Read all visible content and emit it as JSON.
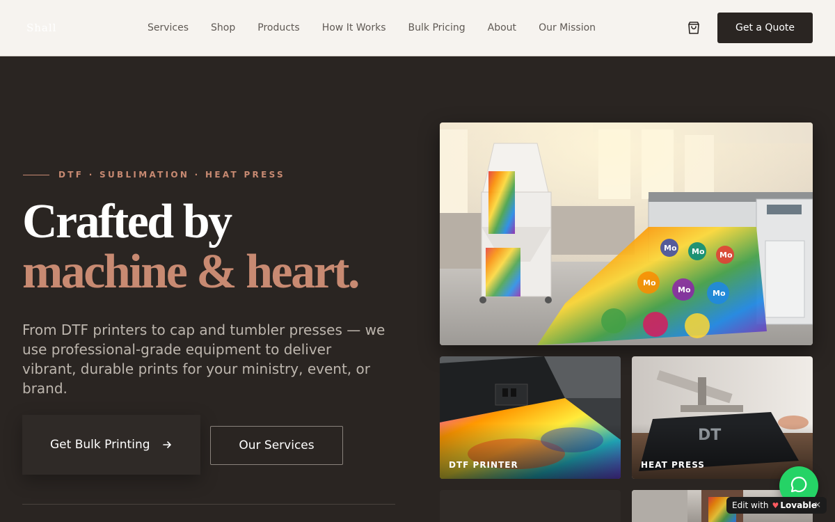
{
  "header": {
    "logo": "Shall",
    "nav": [
      "Services",
      "Shop",
      "Products",
      "How It Works",
      "Bulk Pricing",
      "About",
      "Our Mission"
    ],
    "cta": "Get a Quote"
  },
  "hero": {
    "eyebrow": "DTF · SUBLIMATION · HEAT PRESS",
    "title_line1": "Crafted by",
    "title_line2": "machine & heart.",
    "description": "From DTF printers to cap and tumbler presses — we use professional-grade equipment to deliver vibrant, durable prints for your ministry, event, or brand.",
    "primary_button": "Get Bulk Printing",
    "secondary_button": "Our Services"
  },
  "gallery": {
    "card1_caption": "DTF PRINTER",
    "card2_caption": "HEAT PRESS",
    "main_print_text": "Mo",
    "tshirt_print_text": "DT"
  },
  "badge": {
    "edit_label": "Edit with",
    "brand": "Lovable",
    "close": "×"
  },
  "colors": {
    "accent": "#c88a72",
    "dark": "#2a2522",
    "header_bg": "#f6f3ef"
  }
}
